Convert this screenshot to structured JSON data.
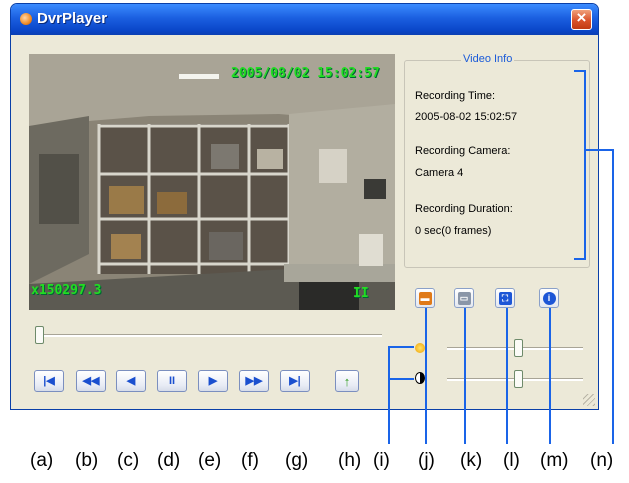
{
  "window": {
    "title": "DvrPlayer",
    "close_glyph": "×",
    "app_icon": "dvr-app-icon"
  },
  "video": {
    "timestamp": "2005/08/02  15:02:57",
    "zoom": "x150297.3",
    "pause_indicator": "II"
  },
  "video_info": {
    "legend": "Video Info",
    "recording_time_label": "Recording Time:",
    "recording_time_value": "2005-08-02 15:02:57",
    "recording_camera_label": "Recording Camera:",
    "recording_camera_value": "Camera 4",
    "recording_duration_label": "Recording Duration:",
    "recording_duration_value": "0 sec(0 frames)"
  },
  "toolbar": [
    {
      "icon": "save-icon",
      "glyph": "▬"
    },
    {
      "icon": "print-icon",
      "glyph": "▭"
    },
    {
      "icon": "fullscreen-icon",
      "glyph": "⛶"
    },
    {
      "icon": "info-icon",
      "glyph": "i"
    }
  ],
  "playback": [
    {
      "icon": "skip-to-start-icon",
      "glyph": "|◀"
    },
    {
      "icon": "rewind-icon",
      "glyph": "◀◀"
    },
    {
      "icon": "step-back-icon",
      "glyph": "◀"
    },
    {
      "icon": "pause-icon",
      "glyph": "II"
    },
    {
      "icon": "play-icon",
      "glyph": "▶"
    },
    {
      "icon": "fast-forward-icon",
      "glyph": "▶▶"
    },
    {
      "icon": "skip-to-end-icon",
      "glyph": "▶|"
    }
  ],
  "open_button": {
    "icon": "open-folder-icon",
    "glyph": "↑"
  },
  "sliders": {
    "seek_position": 0.0,
    "brightness": {
      "icon": "brightness-sun-icon",
      "level": 0.53
    },
    "contrast": {
      "icon": "contrast-icon",
      "level": 0.53
    }
  },
  "labels": [
    "(a)",
    "(b)",
    "(c)",
    "(d)",
    "(e)",
    "(f)",
    "(g)",
    "(h)",
    "(i)",
    "(j)",
    "(k)",
    "(l)",
    "(m)",
    "(n)"
  ],
  "colors": {
    "accent": "#1a64e8",
    "osd": "#22dd22",
    "titlebar": "#0a46c9"
  }
}
